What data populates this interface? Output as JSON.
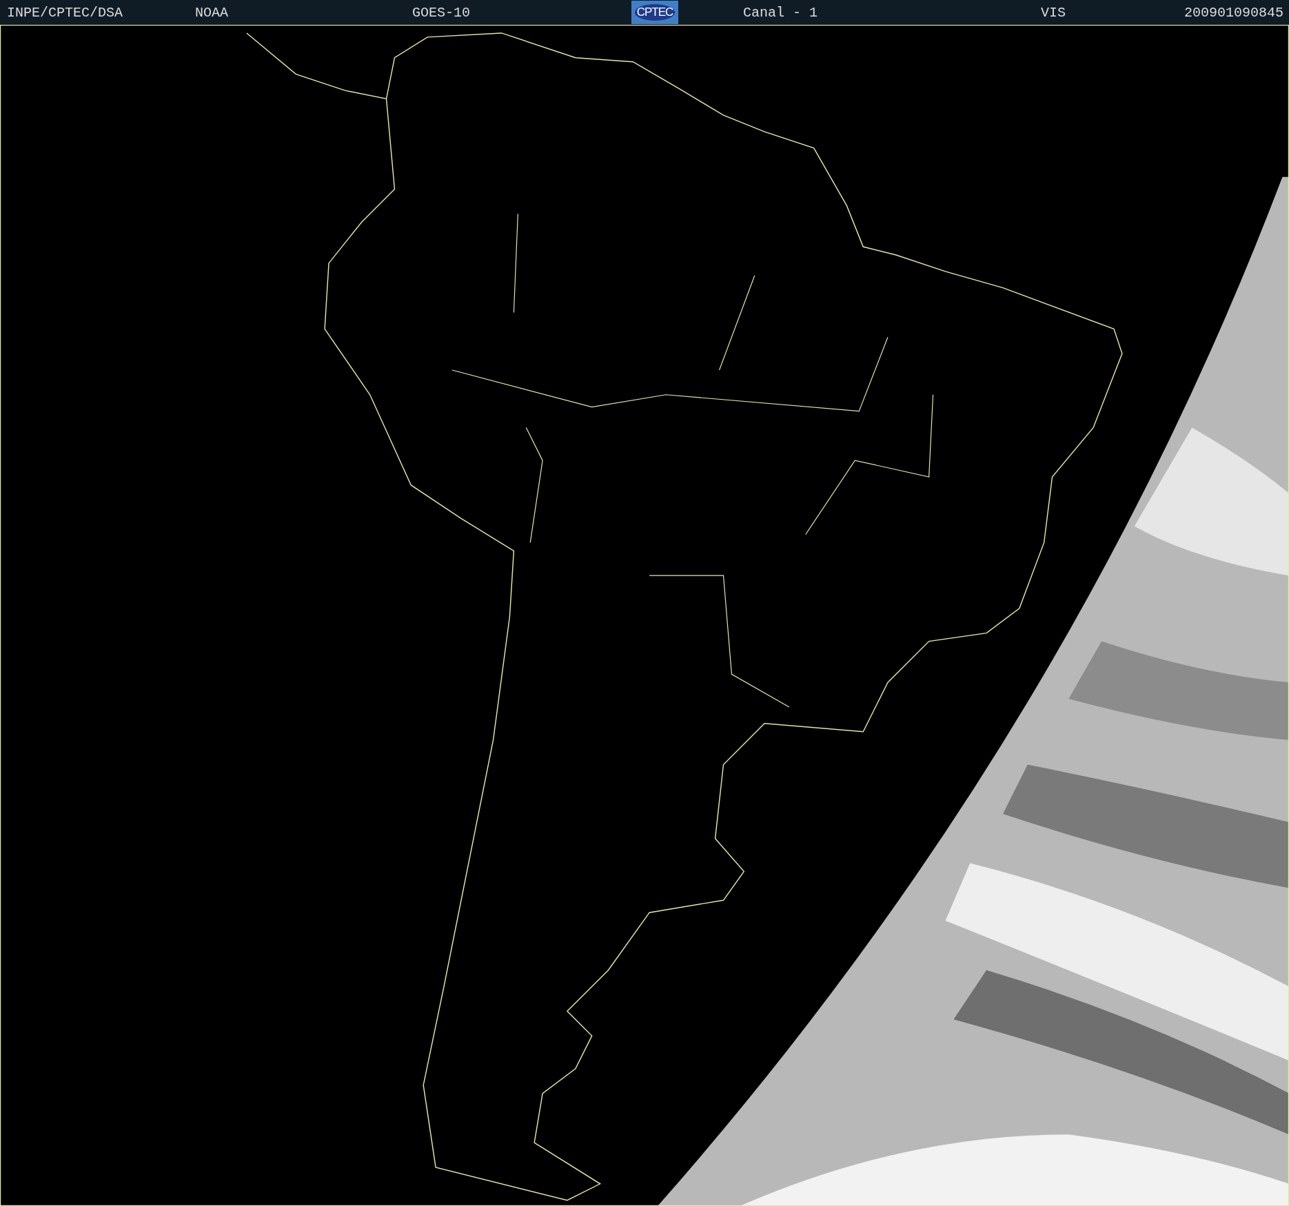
{
  "header": {
    "items": [
      {
        "kind": "text",
        "text": "INPE/CPTEC/DSA"
      },
      {
        "kind": "text",
        "text": "NOAA"
      },
      {
        "kind": "text",
        "text": "GOES-10"
      },
      {
        "kind": "logo",
        "text": "CPTEC"
      },
      {
        "kind": "text",
        "text": "Canal - 1"
      },
      {
        "kind": "text",
        "text": "VIS"
      },
      {
        "kind": "text",
        "text": "200901090845"
      }
    ]
  }
}
